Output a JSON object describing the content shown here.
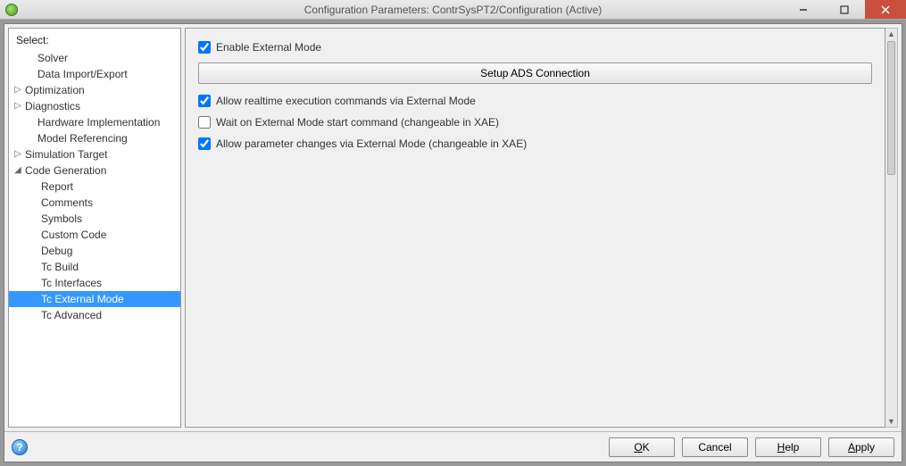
{
  "window": {
    "title": "Configuration Parameters: ContrSysPT2/Configuration (Active)"
  },
  "sidebar": {
    "select_label": "Select:",
    "items": [
      {
        "label": "Solver",
        "level": 0,
        "twisty": ""
      },
      {
        "label": "Data Import/Export",
        "level": 0,
        "twisty": ""
      },
      {
        "label": "Optimization",
        "level": 0,
        "twisty": "▷"
      },
      {
        "label": "Diagnostics",
        "level": 0,
        "twisty": "▷"
      },
      {
        "label": "Hardware Implementation",
        "level": 0,
        "twisty": ""
      },
      {
        "label": "Model Referencing",
        "level": 0,
        "twisty": ""
      },
      {
        "label": "Simulation Target",
        "level": 0,
        "twisty": "▷"
      },
      {
        "label": "Code Generation",
        "level": 0,
        "twisty": "◢"
      },
      {
        "label": "Report",
        "level": 1,
        "twisty": ""
      },
      {
        "label": "Comments",
        "level": 1,
        "twisty": ""
      },
      {
        "label": "Symbols",
        "level": 1,
        "twisty": ""
      },
      {
        "label": "Custom Code",
        "level": 1,
        "twisty": ""
      },
      {
        "label": "Debug",
        "level": 1,
        "twisty": ""
      },
      {
        "label": "Tc Build",
        "level": 1,
        "twisty": ""
      },
      {
        "label": "Tc Interfaces",
        "level": 1,
        "twisty": ""
      },
      {
        "label": "Tc External Mode",
        "level": 1,
        "twisty": "",
        "selected": true
      },
      {
        "label": "Tc Advanced",
        "level": 1,
        "twisty": ""
      }
    ]
  },
  "content": {
    "enable_label": "Enable External Mode",
    "enable_checked": true,
    "setup_button": "Setup ADS Connection",
    "allow_realtime_label": "Allow realtime execution commands via External Mode",
    "allow_realtime_checked": true,
    "wait_start_label": "Wait on External Mode start command (changeable in XAE)",
    "wait_start_checked": false,
    "allow_param_label": "Allow parameter changes via External Mode (changeable in XAE)",
    "allow_param_checked": true
  },
  "footer": {
    "ok": "OK",
    "cancel": "Cancel",
    "help": "Help",
    "apply": "Apply"
  }
}
